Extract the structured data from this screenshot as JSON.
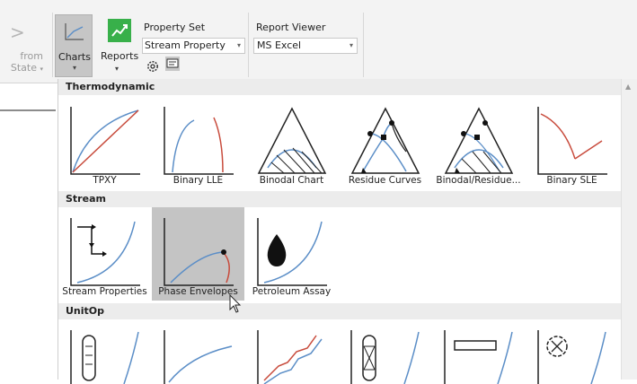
{
  "ribbon": {
    "prev_group": {
      "arrow": ">",
      "line1": "from",
      "line2": "State"
    },
    "charts_button": {
      "label": "Charts",
      "arrow": "▾"
    },
    "reports_button": {
      "label": "Reports",
      "arrow": "▾"
    },
    "property_set": {
      "label": "Property Set",
      "value": "Stream Property"
    },
    "report_viewer": {
      "label": "Report Viewer",
      "value": "MS Excel"
    },
    "icons": [
      "gear-icon",
      "report-icon",
      "chart-icon"
    ]
  },
  "gallery": {
    "categories": [
      {
        "name": "Thermodynamic",
        "items": [
          "TPXY",
          "Binary LLE",
          "Binodal Chart",
          "Residue Curves",
          "Binodal/Residue...",
          "Binary SLE"
        ]
      },
      {
        "name": "Stream",
        "items": [
          "Stream Properties",
          "Phase Envelopes",
          "Petroleum Assay"
        ]
      },
      {
        "name": "UnitOp",
        "items": [
          "",
          "",
          "",
          "",
          "",
          ""
        ]
      }
    ],
    "selected_item": "Phase Envelopes"
  },
  "colors": {
    "blue_curve": "#5b8ec7",
    "red_curve": "#c84b3c",
    "selection": "#c4c4c4",
    "header": "#ececec",
    "reports_icon": "#38b04a"
  }
}
